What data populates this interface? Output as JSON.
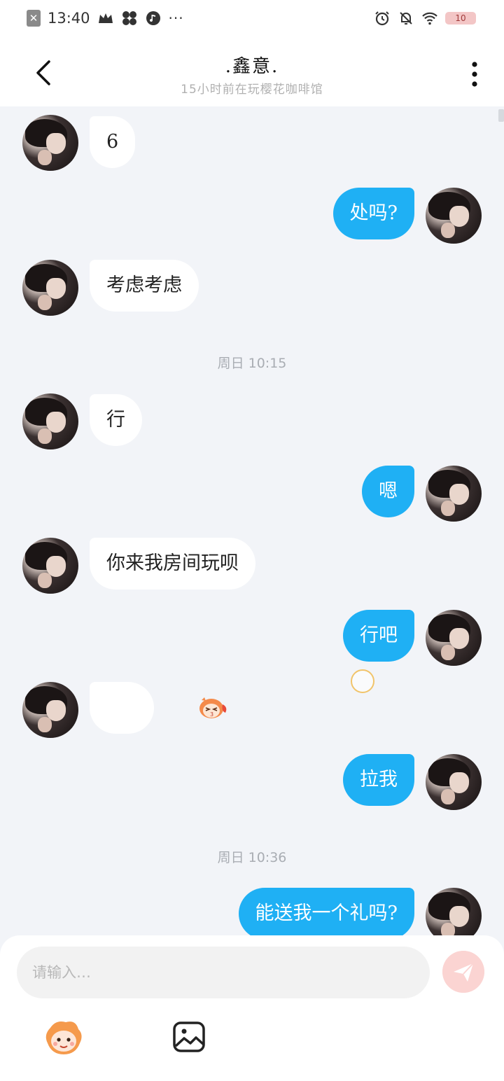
{
  "status_bar": {
    "time": "13:40",
    "battery_level": "10",
    "more_indicator": "···",
    "icons": [
      "close-box-icon",
      "crown-icon",
      "pinwheel-icon",
      "music-note-icon",
      "alarm-icon",
      "bell-off-icon",
      "wifi-icon",
      "battery-icon"
    ]
  },
  "header": {
    "title": ".鑫意.",
    "subtitle": "15小时前在玩樱花咖啡馆"
  },
  "messages": [
    {
      "from": "them",
      "text": "6"
    },
    {
      "from": "me",
      "text": "处吗?"
    },
    {
      "from": "them",
      "text": "考虑考虑"
    },
    {
      "type": "time",
      "text": "周日 10:15"
    },
    {
      "from": "them",
      "text": "行"
    },
    {
      "from": "me",
      "text": "嗯"
    },
    {
      "from": "them",
      "text": "你来我房间玩呗"
    },
    {
      "from": "me",
      "text": "行吧"
    },
    {
      "from": "them",
      "sticker": "cartoon-face-sticker"
    },
    {
      "from": "me",
      "text": "拉我"
    },
    {
      "type": "time",
      "text": "周日 10:36"
    },
    {
      "from": "me",
      "text": "能送我一个礼吗?"
    }
  ],
  "input": {
    "placeholder": "请输入…",
    "value": ""
  },
  "colors": {
    "outgoing_bubble": "#1fb0f4",
    "incoming_bubble": "#ffffff",
    "chat_background": "#f2f4f8",
    "send_button": "#fbd4d2"
  }
}
